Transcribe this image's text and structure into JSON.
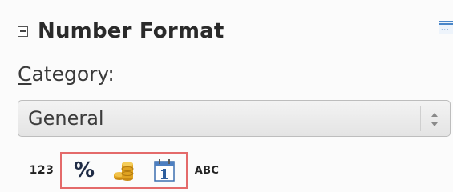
{
  "panel": {
    "title": "Number Format",
    "collapse_icon": "collapse-minus-icon",
    "more_options_icon": "more-options-icon"
  },
  "category": {
    "label_accel": "C",
    "label_rest": "ategory:",
    "selected": "General"
  },
  "toolbar": {
    "number_label": "123",
    "percent_label": "%",
    "currency_icon": "coins-currency-icon",
    "date_icon": "calendar-date-icon",
    "text_label": "ABC"
  },
  "colors": {
    "highlight_border": "#e46a6a",
    "coin_gold": "#e0a321",
    "calendar_blue": "#3d6fb0"
  }
}
